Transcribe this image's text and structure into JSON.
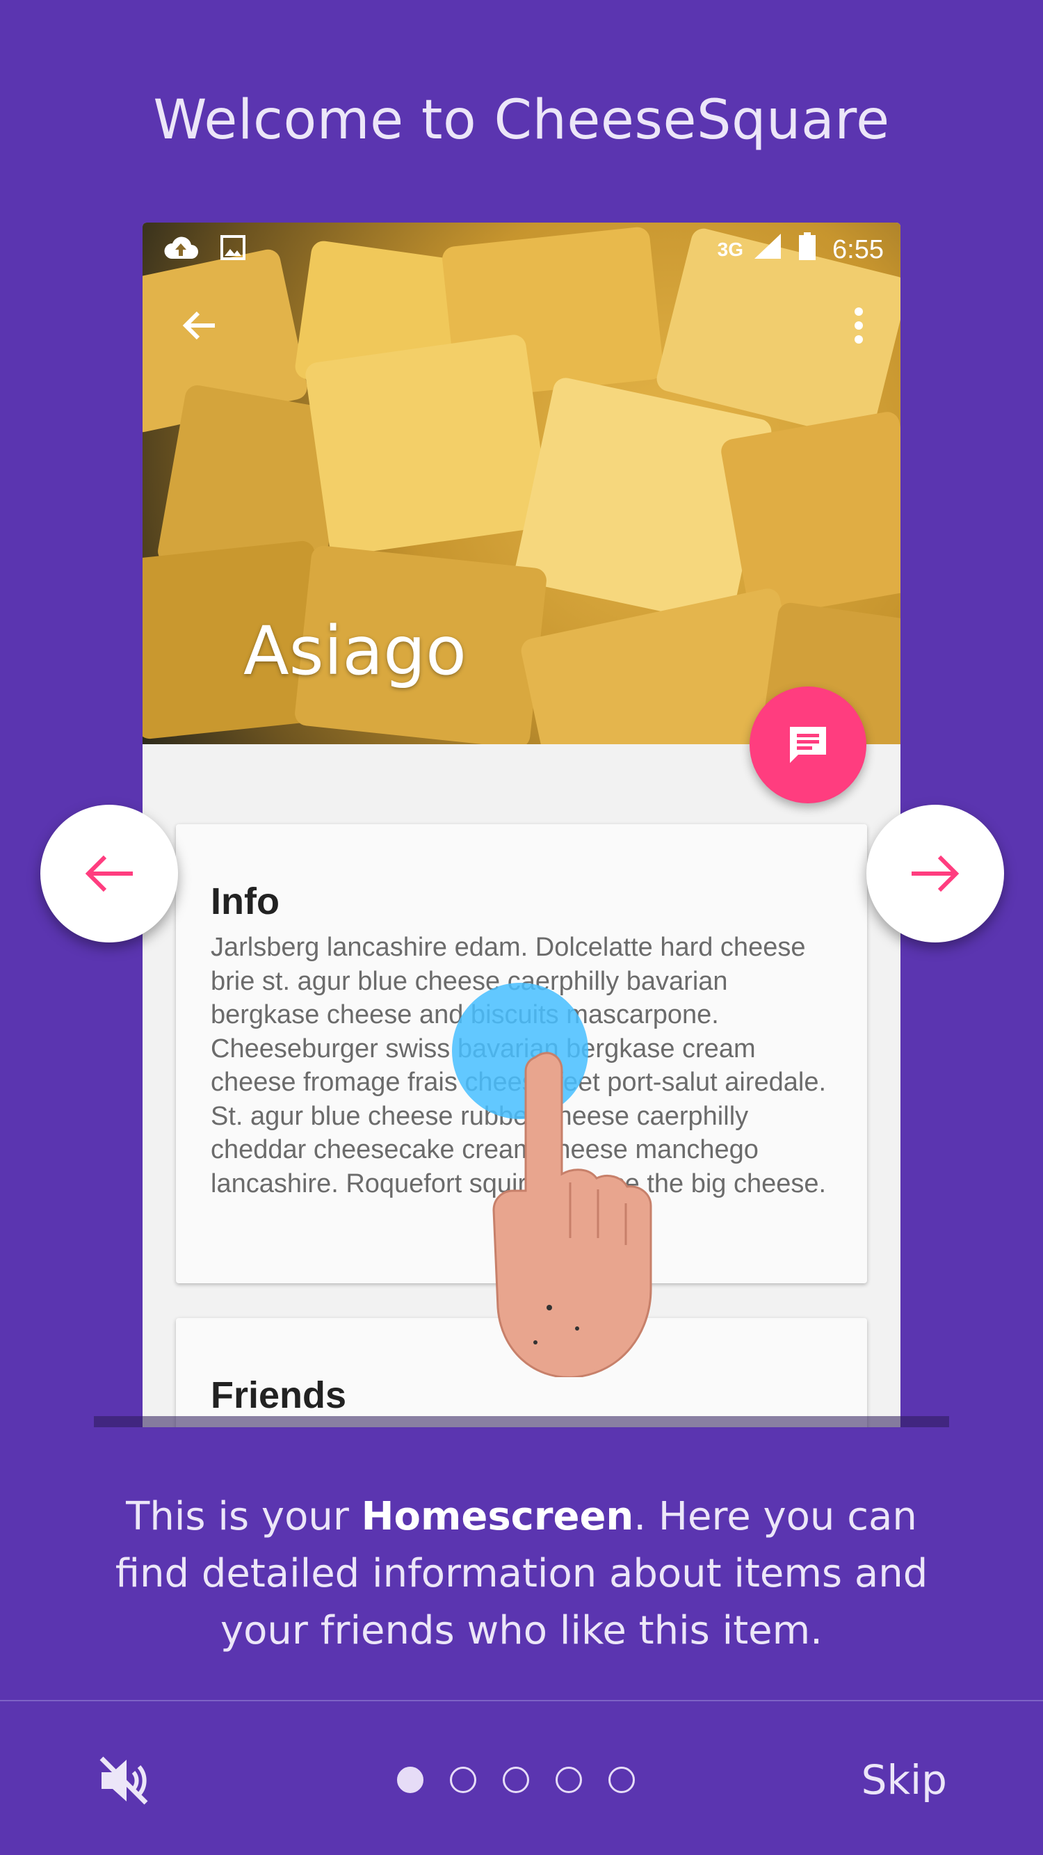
{
  "header": {
    "title": "Welcome to CheeseSquare"
  },
  "phone": {
    "status": {
      "network": "3G",
      "time": "6:55"
    },
    "hero_title": "Asiago",
    "cards": [
      {
        "title": "Info",
        "body": "Jarlsberg lancashire edam. Dolcelatte hard cheese brie st. agur blue cheese caerphilly bavarian bergkase cheese and biscuits mascarpone. Cheeseburger swiss bavarian bergkase cream cheese fromage frais cheesy feet port-salut airedale. St. agur blue cheese rubber cheese caerphilly cheddar cheesecake cream cheese manchego lancashire. Roquefort squirty cheese the big cheese."
      },
      {
        "title": "Friends"
      }
    ],
    "fab_icon": "message-icon"
  },
  "navigation": {
    "prev_icon": "arrow-left-icon",
    "next_icon": "arrow-right-icon"
  },
  "description": {
    "before": "This is your ",
    "bold": "Homescreen",
    "after": ". Here you can find detailed information about items and your friends who like this item."
  },
  "footer": {
    "mute_icon": "volume-off-icon",
    "pages": [
      true,
      false,
      false,
      false,
      false
    ],
    "skip_label": "Skip"
  },
  "colors": {
    "background": "#5b35b0",
    "accent": "#ff3d7f",
    "touch": "#46beff"
  }
}
